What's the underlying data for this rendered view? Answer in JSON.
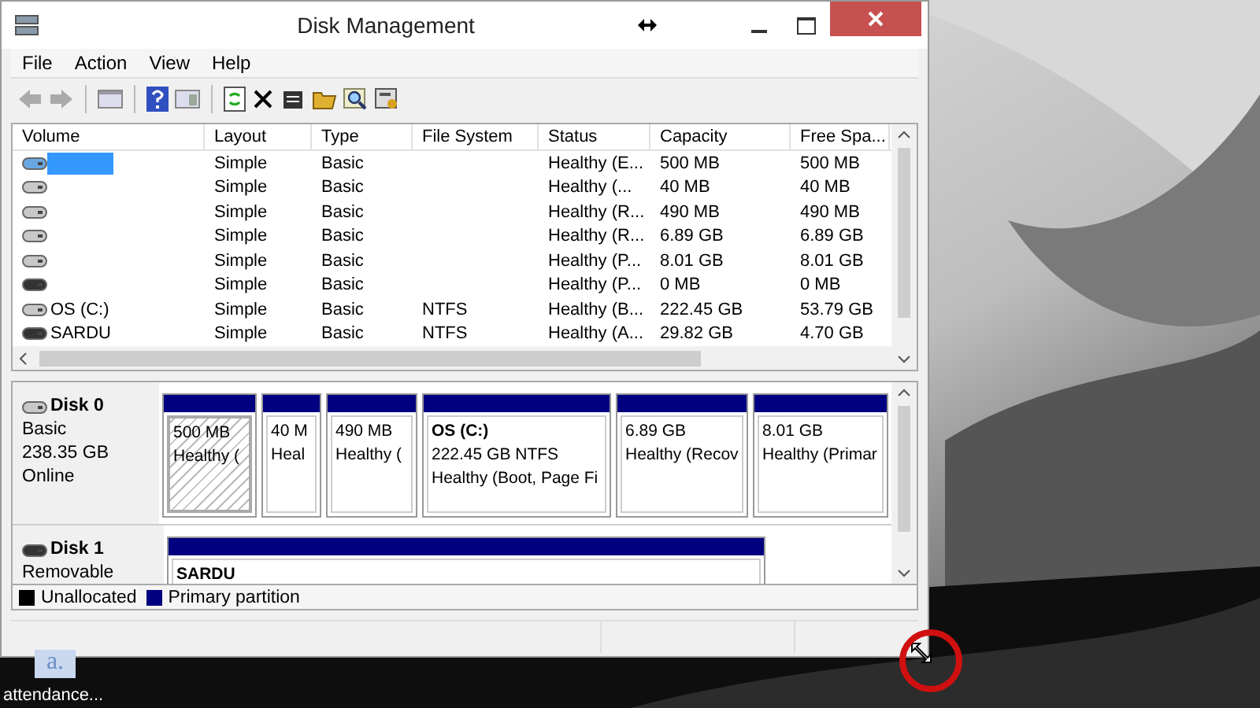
{
  "window": {
    "title": "Disk Management"
  },
  "menu": [
    {
      "label": "File"
    },
    {
      "label": "Action"
    },
    {
      "label": "View"
    },
    {
      "label": "Help"
    }
  ],
  "volume_list": {
    "columns": [
      "Volume",
      "Layout",
      "Type",
      "File System",
      "Status",
      "Capacity",
      "Free Spa..."
    ],
    "rows": [
      {
        "kind": "fixed",
        "selected": true,
        "cells": [
          "",
          "Simple",
          "Basic",
          "",
          "Healthy (E...",
          "500 MB",
          "500 MB"
        ]
      },
      {
        "kind": "fixed",
        "selected": false,
        "cells": [
          "",
          "Simple",
          "Basic",
          "",
          "Healthy (...",
          "40 MB",
          "40 MB"
        ]
      },
      {
        "kind": "fixed",
        "selected": false,
        "cells": [
          "",
          "Simple",
          "Basic",
          "",
          "Healthy (R...",
          "490 MB",
          "490 MB"
        ]
      },
      {
        "kind": "fixed",
        "selected": false,
        "cells": [
          "",
          "Simple",
          "Basic",
          "",
          "Healthy (R...",
          "6.89 GB",
          "6.89 GB"
        ]
      },
      {
        "kind": "fixed",
        "selected": false,
        "cells": [
          "",
          "Simple",
          "Basic",
          "",
          "Healthy (P...",
          "8.01 GB",
          "8.01 GB"
        ]
      },
      {
        "kind": "removable",
        "selected": false,
        "cells": [
          "",
          "Simple",
          "Basic",
          "",
          "Healthy (P...",
          "0 MB",
          "0 MB"
        ]
      },
      {
        "kind": "fixed",
        "selected": false,
        "cells": [
          "OS (C:)",
          "Simple",
          "Basic",
          "NTFS",
          "Healthy (B...",
          "222.45 GB",
          "53.79 GB"
        ]
      },
      {
        "kind": "removable",
        "selected": false,
        "cells": [
          "SARDU",
          "Simple",
          "Basic",
          "NTFS",
          "Healthy (A...",
          "29.82 GB",
          "4.70 GB"
        ]
      }
    ]
  },
  "disks": [
    {
      "kind": "fixed",
      "name": "Disk 0",
      "lines": [
        "Basic",
        "238.35 GB",
        "Online"
      ],
      "partitions": [
        {
          "selected": true,
          "lines": [
            "500 MB",
            "Healthy ("
          ]
        },
        {
          "selected": false,
          "lines": [
            "40 M",
            "Heal"
          ]
        },
        {
          "selected": false,
          "lines": [
            "490 MB",
            "Healthy ("
          ]
        },
        {
          "selected": false,
          "name": "OS  (C:)",
          "lines": [
            "222.45 GB NTFS",
            "Healthy (Boot, Page Fi"
          ]
        },
        {
          "selected": false,
          "lines": [
            "6.89 GB",
            "Healthy (Recov"
          ]
        },
        {
          "selected": false,
          "lines": [
            "8.01 GB",
            "Healthy (Primar"
          ]
        }
      ]
    },
    {
      "kind": "removable",
      "name": "Disk 1",
      "lines": [
        "Removable"
      ],
      "partitions": [
        {
          "selected": false,
          "name": "SARDU"
        }
      ]
    }
  ],
  "legend": [
    {
      "label": "Unallocated",
      "color": "#000000"
    },
    {
      "label": "Primary partition",
      "color": "#000080"
    }
  ],
  "desktop": {
    "icon_label": "attendance...",
    "icon_glyph": "a."
  }
}
